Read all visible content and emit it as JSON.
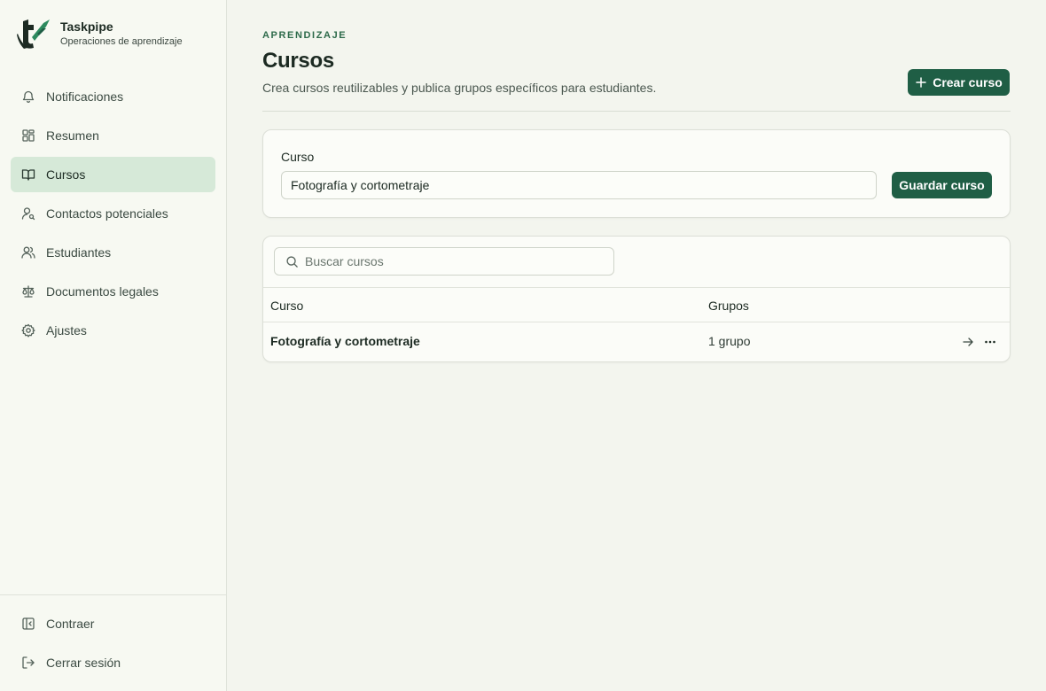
{
  "brand": {
    "name": "Taskpipe",
    "subtitle": "Operaciones de aprendizaje",
    "color": "#1f5e45"
  },
  "sidebar": {
    "items": [
      {
        "label": "Notificaciones",
        "icon": "bell-icon"
      },
      {
        "label": "Resumen",
        "icon": "dashboard-icon"
      },
      {
        "label": "Cursos",
        "icon": "book-icon",
        "active": true
      },
      {
        "label": "Contactos potenciales",
        "icon": "user-search-icon"
      },
      {
        "label": "Estudiantes",
        "icon": "users-icon"
      },
      {
        "label": "Documentos legales",
        "icon": "scale-icon"
      },
      {
        "label": "Ajustes",
        "icon": "gear-icon"
      }
    ],
    "footer": [
      {
        "label": "Contraer",
        "icon": "sidebar-collapse-icon"
      },
      {
        "label": "Cerrar sesión",
        "icon": "logout-icon"
      }
    ],
    "active_bg": "#d6e9d8"
  },
  "header": {
    "eyebrow": "APRENDIZAJE",
    "title": "Cursos",
    "description": "Crea cursos reutilizables y publica grupos específicos para estudiantes.",
    "create_label": "Crear curso"
  },
  "form": {
    "label": "Curso",
    "value": "Fotografía y cortometraje",
    "save_label": "Guardar curso"
  },
  "list": {
    "search_placeholder": "Buscar cursos",
    "columns": [
      "Curso",
      "Grupos"
    ],
    "rows": [
      {
        "course": "Fotografía y cortometraje",
        "groups": "1 grupo"
      }
    ]
  },
  "colors": {
    "primary": "#1f5e45",
    "accent_text": "#2d6a4a",
    "background": "#f3f5ee"
  }
}
